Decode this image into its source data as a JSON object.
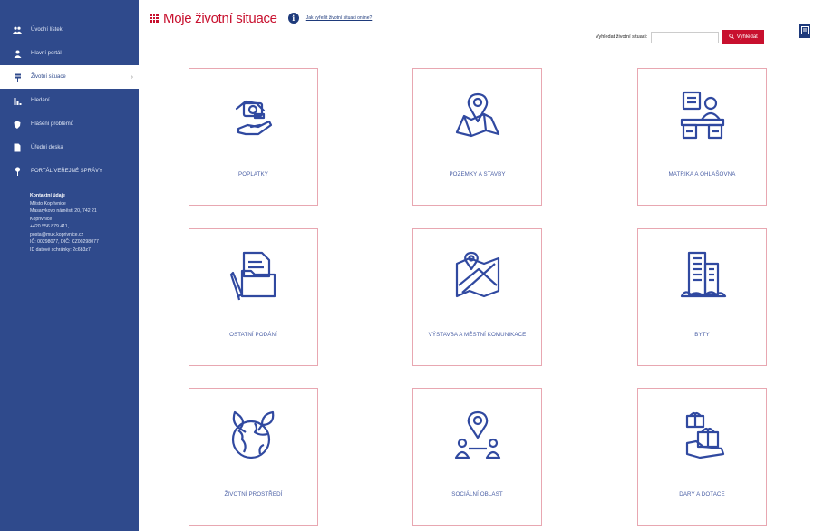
{
  "sidebar": {
    "items": [
      {
        "icon": "people-icon",
        "label": "Úvodní lístek"
      },
      {
        "icon": "person-icon",
        "label": "Hlavní portál"
      },
      {
        "icon": "flag-icon",
        "label": "Životní situace",
        "active": true
      },
      {
        "icon": "bar-chart-icon",
        "label": "Hledání"
      },
      {
        "icon": "shield-icon",
        "label": "Hlášení problémů"
      },
      {
        "icon": "document-icon",
        "label": "Úřední deska"
      },
      {
        "icon": "pin-icon",
        "label": "PORTÁL VEŘEJNÉ SPRÁVY"
      }
    ],
    "contact": {
      "title": "Kontaktní údaje",
      "lines": [
        "Město Kopřivnice",
        "Masarykovo náměstí 20, 742 21",
        "Kopřivnice",
        "+420 556 879 411,",
        "posta@muk.koprivnice.cz",
        "IČ: 00298077, DIČ: CZ00298077",
        "ID datové schránky: 2c6b3z7"
      ]
    }
  },
  "header": {
    "title": "Moje životní situace",
    "help_link": "Jak vyřešit životní situaci online?"
  },
  "search": {
    "label": "Vyhledat životní situaci:",
    "placeholder": "",
    "button_label": "Vyhledat"
  },
  "cards": [
    {
      "label": "POPLATKY",
      "icon": "money-hand-icon"
    },
    {
      "label": "POZEMKY A STAVBY",
      "icon": "map-pin-icon"
    },
    {
      "label": "MATRIKA A OHLAŠOVNA",
      "icon": "office-desk-icon"
    },
    {
      "label": "OSTATNÍ PODÁNÍ",
      "icon": "folder-pen-icon"
    },
    {
      "label": "VÝSTAVBA A MĚSTNÍ KOMUNIKACE",
      "icon": "road-map-icon"
    },
    {
      "label": "BYTY",
      "icon": "building-icon"
    },
    {
      "label": "ŽIVOTNÍ PROSTŘEDÍ",
      "icon": "earth-leaves-icon"
    },
    {
      "label": "SOCIÁLNÍ OBLAST",
      "icon": "people-location-icon"
    },
    {
      "label": "DARY A DOTACE",
      "icon": "gift-hand-icon"
    }
  ],
  "colors": {
    "sidebar": "#2f4a8c",
    "accent": "#c8102e",
    "card_border": "#e8a7b1",
    "icon_blue": "#3049a0"
  }
}
